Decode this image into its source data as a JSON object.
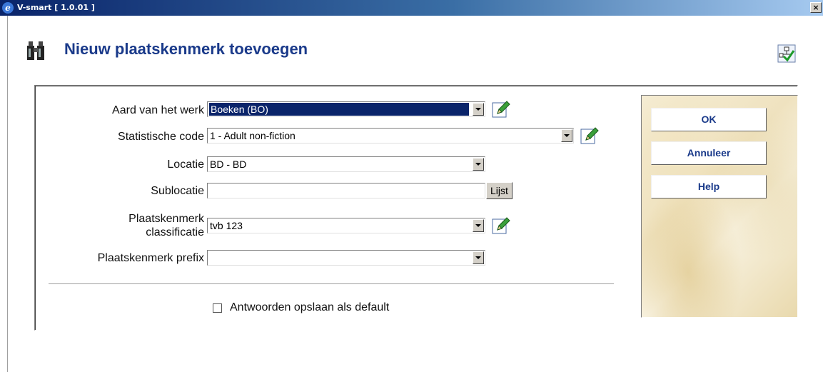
{
  "window": {
    "title": "V-smart [ 1.0.01 ]",
    "close_label": "×"
  },
  "page": {
    "title": "Nieuw plaatskenmerk toevoegen"
  },
  "form": {
    "aard": {
      "label": "Aard van het werk",
      "value": "Boeken (BO)"
    },
    "statistische_code": {
      "label": "Statistische code",
      "value": "1 - Adult non-fiction"
    },
    "locatie": {
      "label": "Locatie",
      "value": "BD - BD"
    },
    "sublocatie": {
      "label": "Sublocatie",
      "value": "",
      "button_label": "Lijst"
    },
    "classificatie": {
      "label_line1": "Plaatskenmerk",
      "label_line2": "classificatie",
      "value": "tvb 123"
    },
    "prefix": {
      "label": "Plaatskenmerk prefix",
      "value": ""
    },
    "save_default": {
      "label": "Antwoorden opslaan als default",
      "checked": false
    }
  },
  "side_buttons": {
    "ok": "OK",
    "annuleer": "Annuleer",
    "help": "Help"
  },
  "icons": {
    "page": "binoculars-icon",
    "corner": "tree-check-icon",
    "edit": "pencil-icon"
  }
}
